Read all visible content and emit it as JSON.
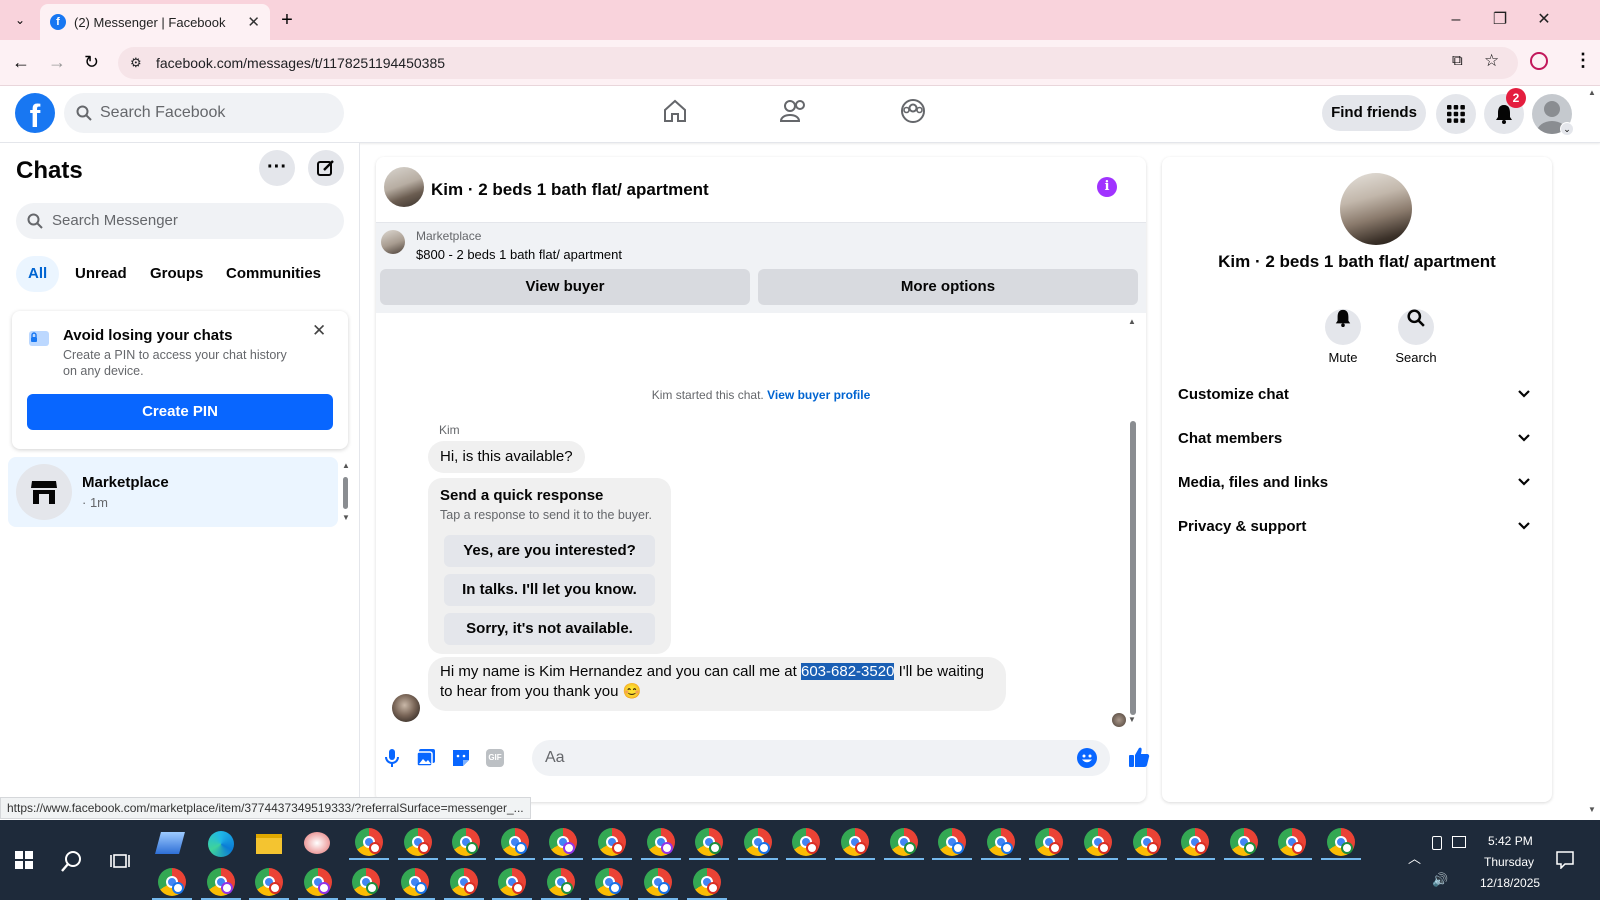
{
  "browser": {
    "tab_title": "(2) Messenger | Facebook",
    "url": "facebook.com/messages/t/1178251194450385",
    "status_url": "https://www.facebook.com/marketplace/item/3774437349519333/?referralSurface=messenger_..."
  },
  "header": {
    "search_placeholder": "Search Facebook",
    "find_friends": "Find friends",
    "notification_count": "2"
  },
  "sidebar": {
    "title": "Chats",
    "search_placeholder": "Search Messenger",
    "filters": [
      "All",
      "Unread",
      "Groups",
      "Communities"
    ],
    "pin_card": {
      "title": "Avoid losing your chats",
      "body": "Create a PIN to access your chat history on any device.",
      "button": "Create PIN"
    },
    "conversations": [
      {
        "name": "Marketplace",
        "meta": "· 1m"
      }
    ]
  },
  "chat": {
    "title": "Kim · 2 beds 1 bath flat/ apartment",
    "marketplace_label": "Marketplace",
    "listing": "$800 - 2 beds 1 bath flat/ apartment",
    "view_buyer": "View buyer",
    "more_options": "More options",
    "started_text": "Kim started this chat.",
    "view_buyer_profile": "View buyer profile",
    "sender_name": "Kim",
    "msg1": "Hi, is this available?",
    "quick_title": "Send a quick response",
    "quick_sub": "Tap a response to send it to the buyer.",
    "quick_responses": [
      "Yes, are you interested?",
      "In talks. I'll let you know.",
      "Sorry, it's not available."
    ],
    "msg2_before": "Hi my name is Kim Hernandez and you can call me at ",
    "msg2_phone": "603-682-3520",
    "msg2_after": " I'll be waiting to hear from you thank you",
    "msg2_emoji": "😊",
    "composer_placeholder": "Aa"
  },
  "details": {
    "title": "Kim · 2 beds 1 bath flat/ apartment",
    "mute": "Mute",
    "search": "Search",
    "sections": [
      "Customize chat",
      "Chat members",
      "Media, files and links",
      "Privacy & support"
    ]
  },
  "taskbar": {
    "time": "5:42 PM",
    "day": "Thursday",
    "date": "12/18/2025"
  },
  "colors": {
    "fb_blue": "#1877f2",
    "button_blue": "#0866ff",
    "tab_pink": "#f9d3dc",
    "badge_red": "#e41e3f",
    "info_purple": "#a033ff"
  }
}
